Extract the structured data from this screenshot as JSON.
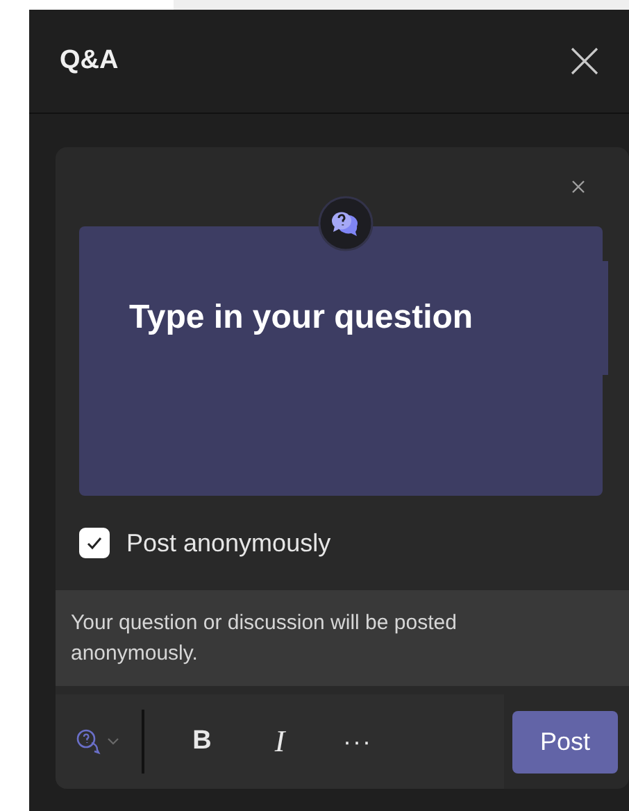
{
  "panel": {
    "title": "Q&A"
  },
  "composer": {
    "prompt": "Type in your question",
    "anonymous": {
      "label": "Post anonymously",
      "checked": true
    },
    "note": "Your question or discussion will be posted anonymously.",
    "toolbar": [
      {
        "kind": "bold",
        "label": "B"
      },
      {
        "kind": "italic",
        "label": "I"
      },
      {
        "kind": "more",
        "label": "···"
      }
    ],
    "post_button": "Post"
  }
}
